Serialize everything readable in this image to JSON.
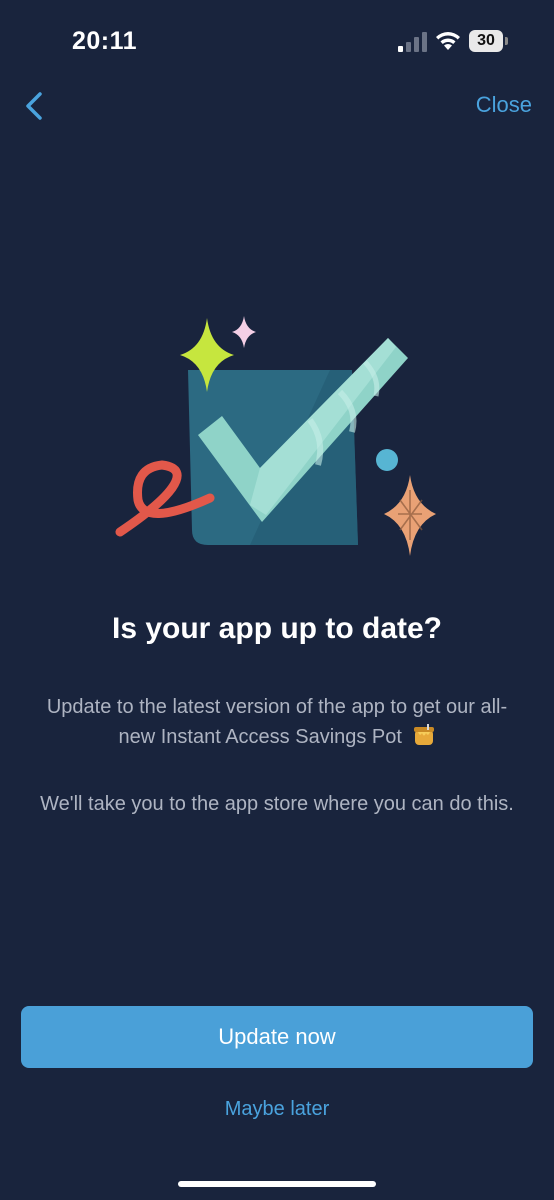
{
  "status_bar": {
    "time": "20:11",
    "battery_level": "30",
    "signal_icon": "cellular-signal-icon",
    "wifi_icon": "wifi-icon"
  },
  "nav": {
    "back_icon": "chevron-left-icon",
    "close_label": "Close"
  },
  "content": {
    "title": "Is your app up to date?",
    "paragraph_1": "Update to the latest version of the app to get our all-new Instant Access Savings Pot",
    "paragraph_1_emoji": "honey-pot-icon",
    "paragraph_2": "We'll take you to the app store where you can do this."
  },
  "actions": {
    "primary_label": "Update now",
    "secondary_label": "Maybe later"
  },
  "colors": {
    "background": "#19243d",
    "accent": "#4aa0d8",
    "text_muted": "#aeb4c2"
  }
}
